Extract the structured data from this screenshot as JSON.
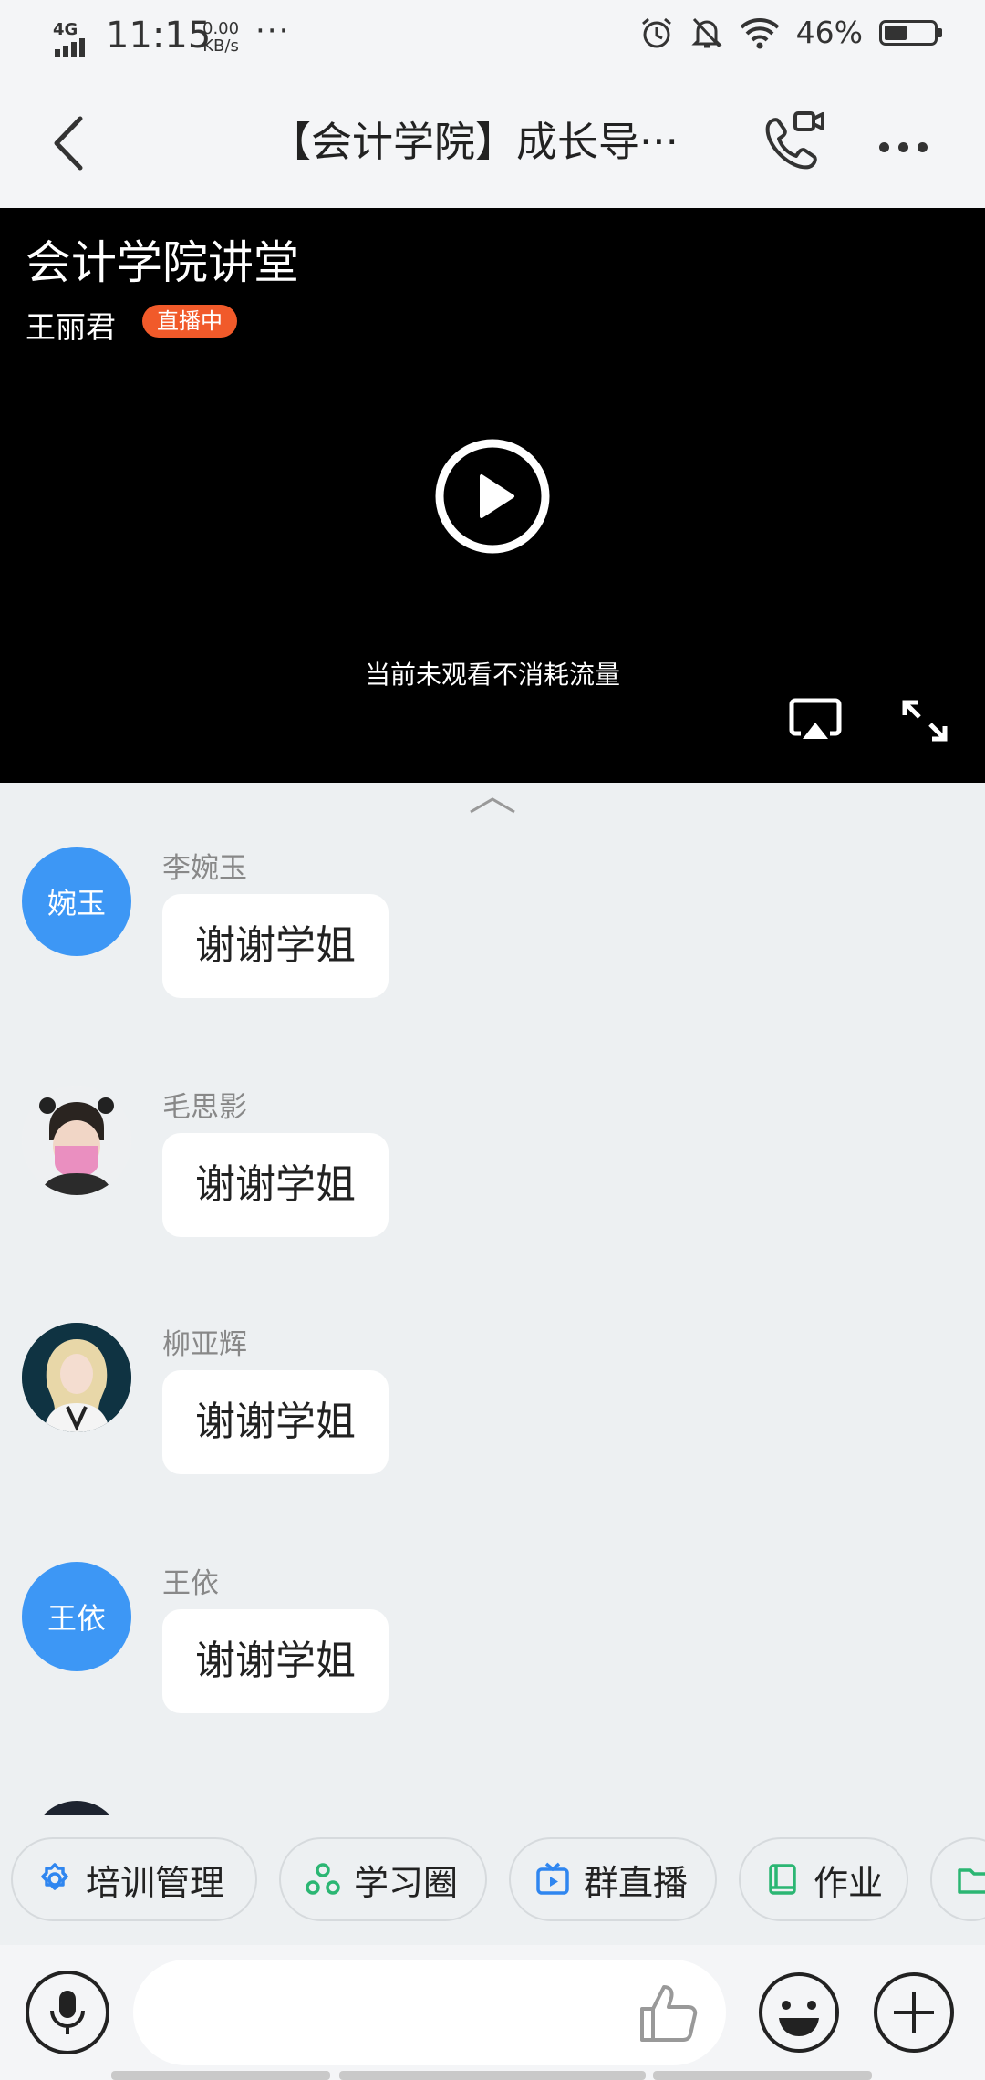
{
  "status_bar": {
    "network": "4G",
    "time": "11:15",
    "speed_value": "0.00",
    "speed_unit": "KB/s",
    "more": "···",
    "battery_percent": "46%",
    "battery_level": 0.46,
    "icons": [
      "alarm-icon",
      "mute-icon",
      "wifi-icon"
    ]
  },
  "header": {
    "title": "【会计学院】成长导···"
  },
  "live": {
    "title": "会计学院讲堂",
    "host": "王丽君",
    "badge": "直播中",
    "badge_color": "#f15a2a",
    "hint": "当前未观看不消耗流量"
  },
  "messages": [
    {
      "sender": "李婉玉",
      "avatar_text": "婉玉",
      "text": "谢谢学姐"
    },
    {
      "sender": "毛思影",
      "avatar_text": "",
      "text": "谢谢学姐"
    },
    {
      "sender": "柳亚辉",
      "avatar_text": "",
      "text": "谢谢学姐"
    },
    {
      "sender": "王依",
      "avatar_text": "王依",
      "text": "谢谢学姐"
    }
  ],
  "partial_sender": "",
  "quick_actions": [
    {
      "label": "培训管理",
      "icon": "gear-icon"
    },
    {
      "label": "学习圈",
      "icon": "circle-group-icon"
    },
    {
      "label": "群直播",
      "icon": "tv-play-icon"
    },
    {
      "label": "作业",
      "icon": "book-icon"
    },
    {
      "label": "",
      "icon": "folder-icon"
    }
  ],
  "input": {
    "placeholder": ""
  },
  "colors": {
    "accent_blue": "#3d97f5",
    "live_orange": "#f15a2a",
    "chip_green": "#2bb673"
  }
}
